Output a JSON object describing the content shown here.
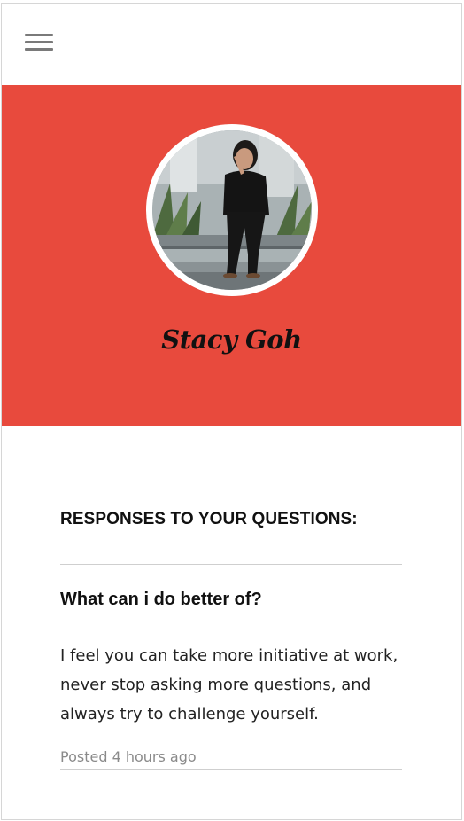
{
  "header": {
    "menu_icon": "hamburger-menu-icon"
  },
  "profile": {
    "name": "Stacy Goh",
    "avatar_description": "Photo of Stacy Goh",
    "hero_color": "#e84a3d"
  },
  "responses": {
    "section_title": "RESPONSES TO YOUR QUESTIONS:",
    "items": [
      {
        "question": "What can i do better of?",
        "answer": "I feel you can take more initiative at work, never stop asking more questions, and always try to challenge yourself.",
        "meta": "Posted 4 hours ago"
      }
    ]
  }
}
